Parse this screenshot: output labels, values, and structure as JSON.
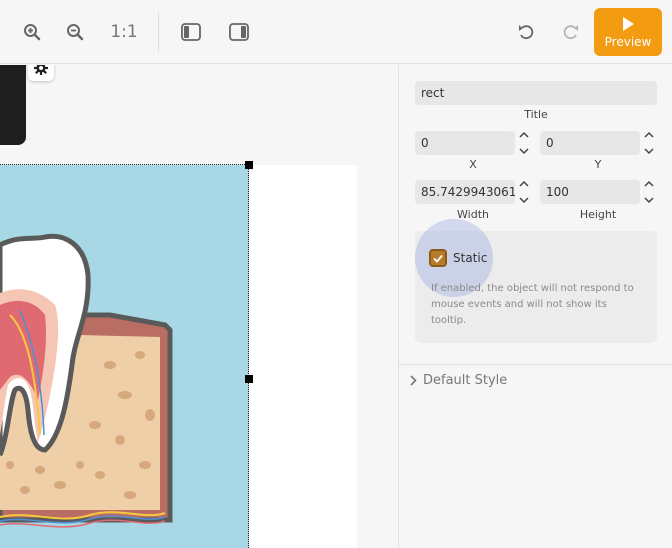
{
  "toolbar": {
    "zoom_reset_label": "1:1",
    "preview_label": "Preview",
    "zoom_in_icon": "zoom-in-icon",
    "zoom_out_icon": "zoom-out-icon",
    "undo_icon": "undo-icon",
    "redo_icon": "redo-icon",
    "accent_color": "#f39c12"
  },
  "properties": {
    "title_value": "rect",
    "title_label": "Title",
    "x_value": "0",
    "x_label": "X",
    "y_value": "0",
    "y_label": "Y",
    "width_value": "85.74299430612",
    "width_label": "Width",
    "height_value": "100",
    "height_label": "Height",
    "static_label": "Static",
    "static_checked": true,
    "static_help": "If enabled, the object will not respond to mouse events and will not show its tooltip.",
    "default_style_label": "Default Style"
  }
}
